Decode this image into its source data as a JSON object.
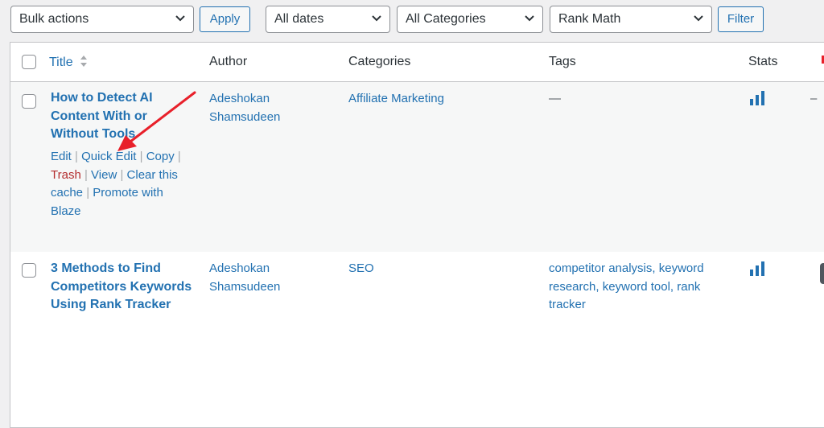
{
  "toolbar": {
    "bulk_actions": "Bulk actions",
    "apply": "Apply",
    "dates": "All dates",
    "categories": "All Categories",
    "seo_filter": "Rank Math",
    "filter": "Filter"
  },
  "table": {
    "columns": {
      "title": "Title",
      "author": "Author",
      "categories": "Categories",
      "tags": "Tags",
      "stats": "Stats"
    },
    "rows": [
      {
        "title_lines": [
          "How to Detect AI",
          "Content With or",
          "Without Tools"
        ],
        "actions": {
          "edit": "Edit",
          "quick_edit": "Quick Edit",
          "copy": "Copy",
          "trash": "Trash",
          "view": "View",
          "clear_cache_1": "Clear this",
          "clear_cache_2": "cache",
          "promote_1": "Promote with",
          "promote_2": "Blaze"
        },
        "author_lines": [
          "Adeshokan",
          "Shamsudeen"
        ],
        "category": "Affiliate Marketing",
        "tags_lines": [
          "—"
        ],
        "extra": "–"
      },
      {
        "title_lines": [
          "3 Methods to Find",
          "Competitors Keywords",
          "Using Rank Tracker"
        ],
        "author_lines": [
          "Adeshokan",
          "Shamsudeen"
        ],
        "category": "SEO",
        "tags_lines": [
          "competitor analysis, keyword",
          "research, keyword tool, rank",
          "tracker"
        ]
      }
    ]
  },
  "colors": {
    "link": "#2271b1",
    "trash": "#b32d2e",
    "annotation_arrow": "#e8202a"
  },
  "icons": {
    "stats": "bar-chart-icon",
    "dropdown": "chevron-down-icon",
    "sort": "sort-arrows-icon"
  }
}
